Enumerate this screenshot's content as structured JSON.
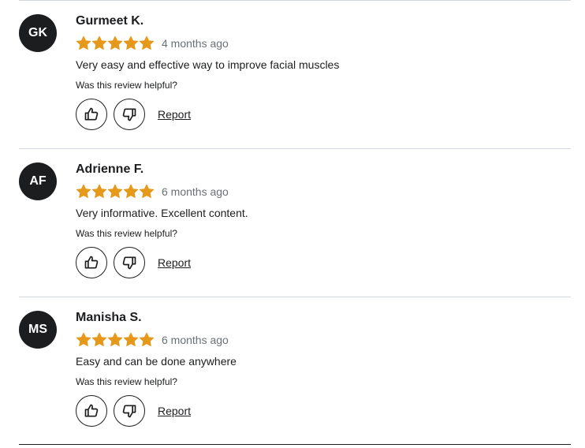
{
  "colors": {
    "star": "#e59819",
    "avatar_bg": "#1c1d1f",
    "text": "#1c1d1f",
    "muted": "#6a6f73",
    "divider": "#d1d7dc"
  },
  "reviews": [
    {
      "initials": "GK",
      "name": "Gurmeet K.",
      "rating": 5,
      "time_ago": "4 months ago",
      "text": "Very easy and effective way to improve facial muscles",
      "helpful_prompt": "Was this review helpful?",
      "like_icon": "thumbs-up-icon",
      "dislike_icon": "thumbs-down-icon",
      "report_label": "Report"
    },
    {
      "initials": "AF",
      "name": "Adrienne F.",
      "rating": 5,
      "time_ago": "6 months ago",
      "text": "Very informative. Excellent content.",
      "helpful_prompt": "Was this review helpful?",
      "like_icon": "thumbs-up-icon",
      "dislike_icon": "thumbs-down-icon",
      "report_label": "Report"
    },
    {
      "initials": "MS",
      "name": "Manisha S.",
      "rating": 5,
      "time_ago": "6 months ago",
      "text": "Easy and can be done anywhere",
      "helpful_prompt": "Was this review helpful?",
      "like_icon": "thumbs-up-icon",
      "dislike_icon": "thumbs-down-icon",
      "report_label": "Report"
    }
  ]
}
